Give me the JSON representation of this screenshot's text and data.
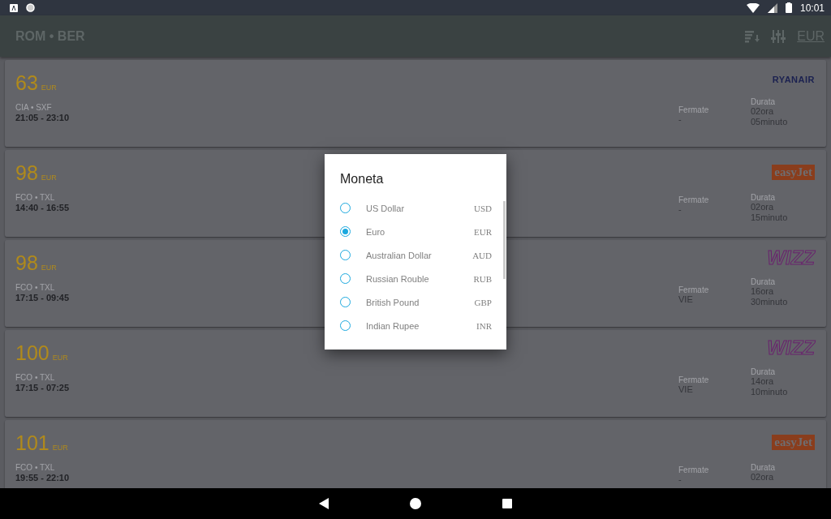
{
  "status_bar": {
    "time": "10:01"
  },
  "toolbar": {
    "title": "ROM • BER",
    "currency": "EUR"
  },
  "flights": [
    {
      "price": "63",
      "currency": "EUR",
      "route": "CIA • SXF",
      "times": "21:05 - 23:10",
      "stops_label": "Fermate",
      "stops": "-",
      "duration_label": "Durata",
      "duration": [
        "02ora",
        "05minuto"
      ],
      "airline": {
        "kind": "ryanair",
        "name": "RYANAIR"
      }
    },
    {
      "price": "98",
      "currency": "EUR",
      "route": "FCO • TXL",
      "times": "14:40 - 16:55",
      "stops_label": "Fermate",
      "stops": "-",
      "duration_label": "Durata",
      "duration": [
        "02ora",
        "15minuto"
      ],
      "airline": {
        "kind": "easyjet",
        "name": "easyJet"
      }
    },
    {
      "price": "98",
      "currency": "EUR",
      "route": "FCO • TXL",
      "times": "17:15 - 09:45",
      "stops_label": "Fermate",
      "stops": "VIE",
      "duration_label": "Durata",
      "duration": [
        "16ora",
        "30minuto"
      ],
      "airline": {
        "kind": "wizz",
        "name": "WIZZ"
      }
    },
    {
      "price": "100",
      "currency": "EUR",
      "route": "FCO • TXL",
      "times": "17:15 - 07:25",
      "stops_label": "Fermate",
      "stops": "VIE",
      "duration_label": "Durata",
      "duration": [
        "14ora",
        "10minuto"
      ],
      "airline": {
        "kind": "wizz",
        "name": "WIZZ"
      }
    },
    {
      "price": "101",
      "currency": "EUR",
      "route": "FCO • TXL",
      "times": "19:55 - 22:10",
      "stops_label": "Fermate",
      "stops": "-",
      "duration_label": "Durata",
      "duration": [
        "02ora"
      ],
      "airline": {
        "kind": "easyjet",
        "name": "easyJet"
      }
    }
  ],
  "dialog": {
    "title": "Moneta",
    "options": [
      {
        "name": "US Dollar",
        "code": "USD",
        "selected": false
      },
      {
        "name": "Euro",
        "code": "EUR",
        "selected": true
      },
      {
        "name": "Australian Dollar",
        "code": "AUD",
        "selected": false
      },
      {
        "name": "Russian Rouble",
        "code": "RUB",
        "selected": false
      },
      {
        "name": "British Pound",
        "code": "GBP",
        "selected": false
      },
      {
        "name": "Indian Rupee",
        "code": "INR",
        "selected": false
      }
    ]
  }
}
